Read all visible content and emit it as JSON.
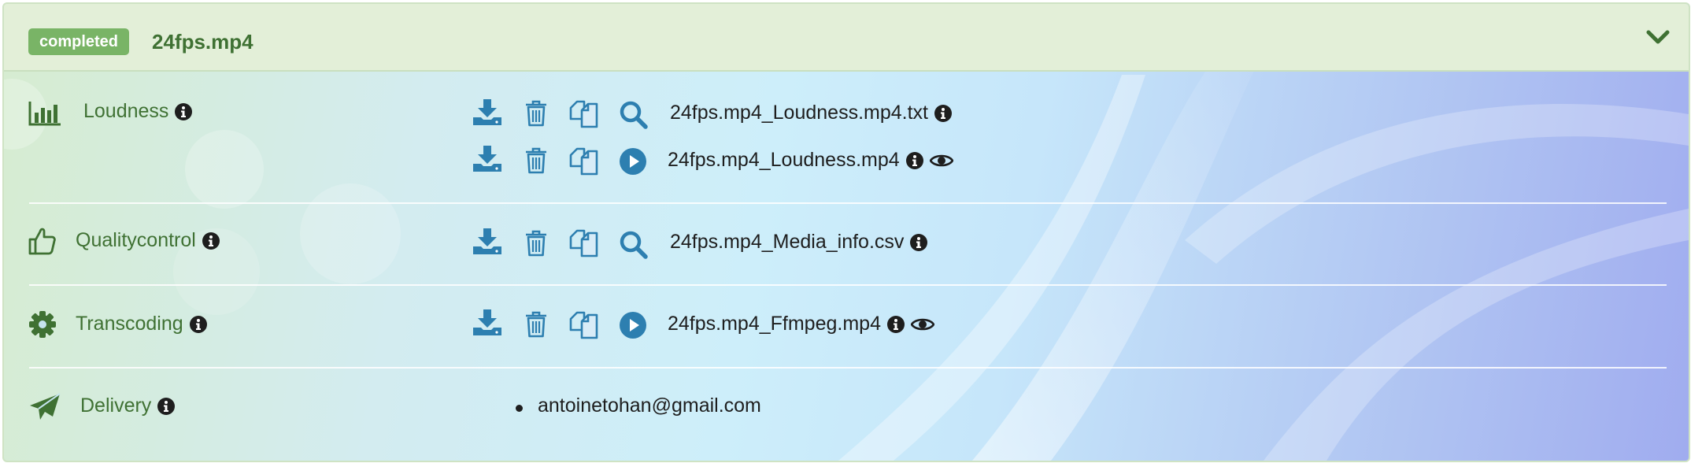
{
  "header": {
    "status_badge": "completed",
    "file_title": "24fps.mp4"
  },
  "sections": {
    "loudness": {
      "label": "Loudness",
      "files": [
        {
          "name": "24fps.mp4_Loudness.mp4.txt",
          "preview_action": "search-icon"
        },
        {
          "name": "24fps.mp4_Loudness.mp4",
          "preview_action": "play-icon"
        }
      ]
    },
    "qualitycontrol": {
      "label": "Qualitycontrol",
      "files": [
        {
          "name": "24fps.mp4_Media_info.csv",
          "preview_action": "search-icon"
        }
      ]
    },
    "transcoding": {
      "label": "Transcoding",
      "files": [
        {
          "name": "24fps.mp4_Ffmpeg.mp4",
          "preview_action": "play-icon"
        }
      ]
    },
    "delivery": {
      "label": "Delivery",
      "recipients": [
        "antoinetohan@gmail.com"
      ]
    }
  },
  "colors": {
    "accent_green": "#3f7133",
    "badge_green": "#79b466",
    "action_blue": "#2d7fb0",
    "header_bg": "#e3efd8"
  }
}
